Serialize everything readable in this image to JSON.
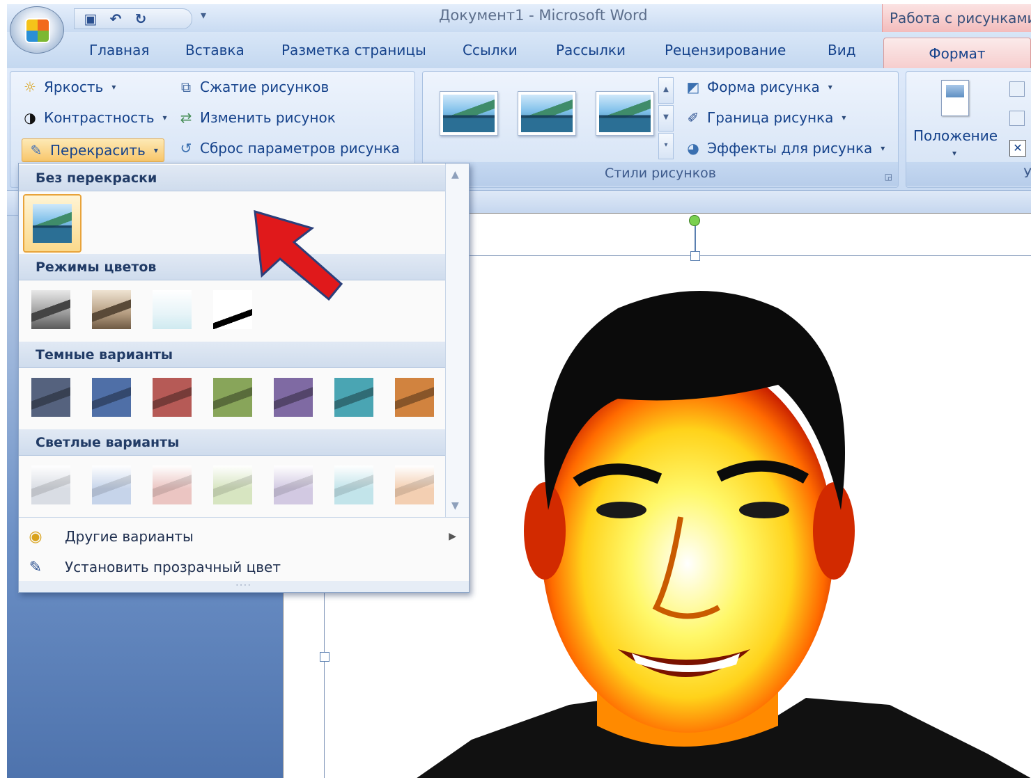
{
  "window": {
    "title": "Документ1 - Microsoft Word",
    "context_title": "Работа с рисунками"
  },
  "tabs": [
    "Главная",
    "Вставка",
    "Разметка страницы",
    "Ссылки",
    "Рассылки",
    "Рецензирование",
    "Вид",
    "Формат"
  ],
  "active_tab": "Формат",
  "ribbon": {
    "adjust": {
      "brightness": "Яркость",
      "contrast": "Контрастность",
      "recolor": "Перекрасить",
      "compress": "Сжатие рисунков",
      "change": "Изменить рисунок",
      "reset": "Сброс параметров рисунка"
    },
    "styles": {
      "shape": "Форма рисунка",
      "border": "Граница рисунка",
      "effects": "Эффекты для рисунка",
      "label": "Стили рисунков"
    },
    "arrange": {
      "position": "Положение",
      "label_fragment": "У"
    }
  },
  "recolor_menu": {
    "sections": {
      "none": "Без перекраски",
      "modes": "Режимы цветов",
      "dark": "Темные варианты",
      "light": "Светлые варианты"
    },
    "items": {
      "more": "Другие варианты",
      "transparent": "Установить прозрачный цвет"
    },
    "color_modes": [
      "grayscale",
      "sepia",
      "washout",
      "black-and-white"
    ],
    "dark_colors": [
      "#55627e",
      "#4f6fa7",
      "#b65a56",
      "#88a55a",
      "#7f6aa3",
      "#4aa5b3",
      "#d1833f"
    ],
    "light_colors": [
      "#d9dde4",
      "#c6d4ea",
      "#ebc5c2",
      "#d7e5c1",
      "#d2c9e2",
      "#c2e4ea",
      "#f3cfb2"
    ]
  },
  "icons": {
    "qat": [
      "save-icon",
      "undo-icon",
      "redo-icon"
    ],
    "brightness": "sun-icon",
    "contrast": "contrast-icon",
    "recolor": "paint-icon",
    "more": "palette-icon",
    "transparent": "pen-icon"
  },
  "colors": {
    "ribbon_blue": "#c8daf2",
    "context_pink": "#f3bcbc",
    "highlight_orange": "#f8c66a",
    "arrow_red": "#e0191b"
  }
}
